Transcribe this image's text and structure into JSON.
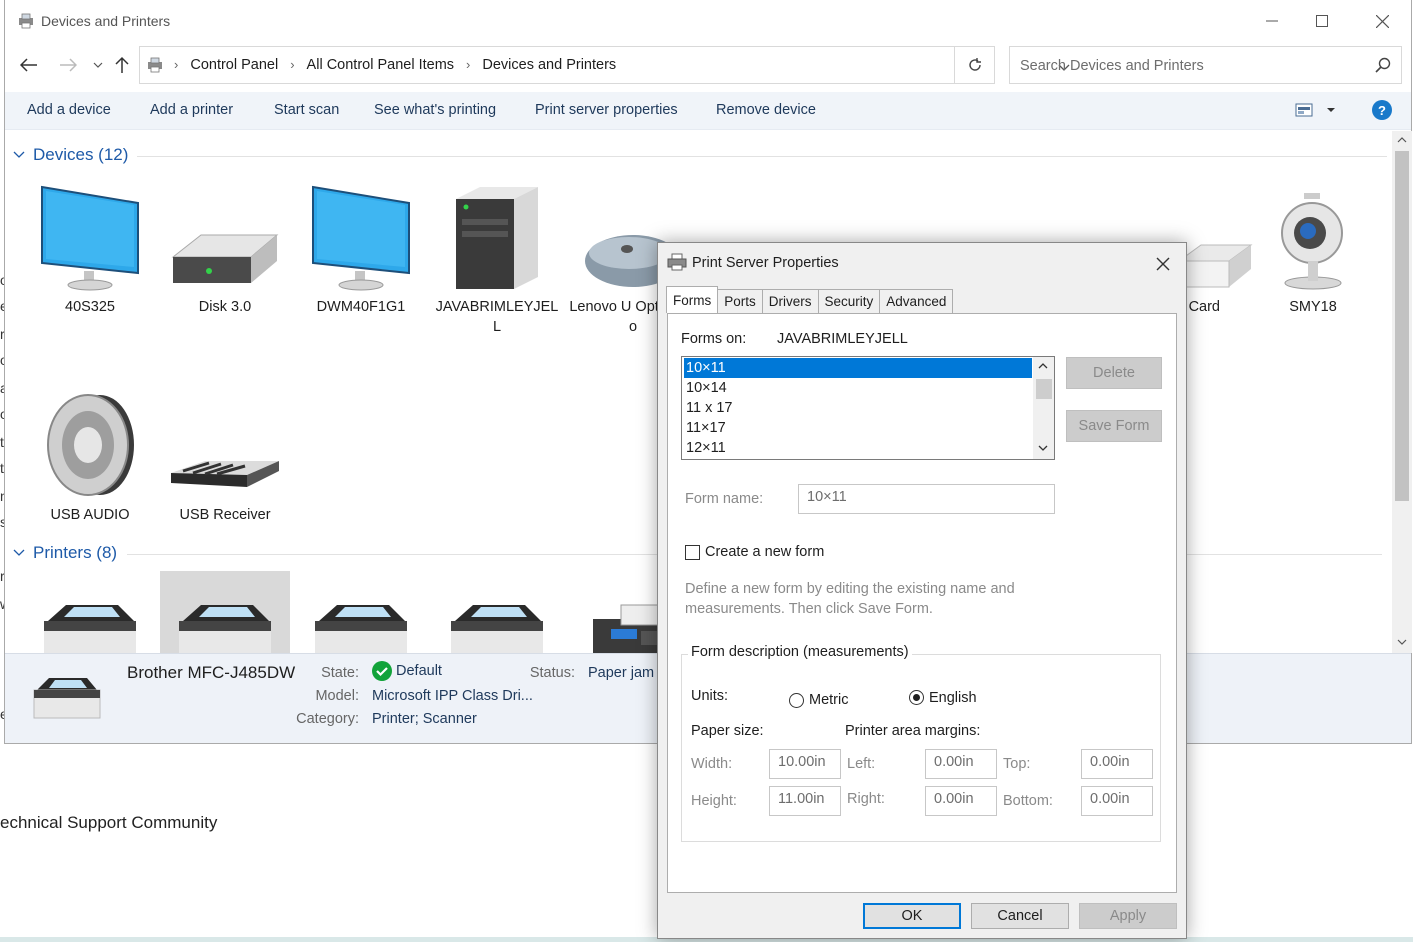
{
  "background": {
    "left_letters": [
      "o",
      "e",
      "r",
      "o",
      "a",
      "o",
      "t",
      "t",
      "n",
      "s",
      "ri",
      "w",
      "e"
    ],
    "community_text": "echnical Support Community"
  },
  "window": {
    "title": "Devices and Printers",
    "address": [
      "Control Panel",
      "All Control Panel Items",
      "Devices and Printers"
    ],
    "search_placeholder": "Search Devices and Printers"
  },
  "toolbar": {
    "items": [
      "Add a device",
      "Add a printer",
      "Start scan",
      "See what's printing",
      "Print server properties",
      "Remove device"
    ],
    "help_label": "?"
  },
  "groups": {
    "devices_label": "Devices (12)",
    "printers_label": "Printers (8)"
  },
  "devices": [
    {
      "label": "40S325",
      "icon": "monitor-icon"
    },
    {
      "label": "Disk 3.0",
      "icon": "drive-icon"
    },
    {
      "label": "DWM40F1G1",
      "icon": "monitor-icon"
    },
    {
      "label": "JAVABRIMLEYJEL L",
      "icon": "computer-tower-icon"
    },
    {
      "label": "Lenovo U Optical Mo",
      "icon": "mouse-icon"
    },
    {
      "label": "Card",
      "icon": "card-reader-icon"
    },
    {
      "label": "SMY18",
      "icon": "webcam-icon"
    },
    {
      "label": "USB  AUDIO",
      "icon": "speaker-icon"
    },
    {
      "label": "USB Receiver",
      "icon": "keyboard-icon"
    }
  ],
  "details": {
    "name": "Brother MFC-J485DW",
    "state_label": "State:",
    "state_value": "Default",
    "status_label": "Status:",
    "status_value": "Paper jam",
    "model_label": "Model:",
    "model_value": "Microsoft IPP Class Dri...",
    "category_label": "Category:",
    "category_value": "Printer; Scanner"
  },
  "dialog": {
    "title": "Print Server Properties",
    "tabs": [
      "Forms",
      "Ports",
      "Drivers",
      "Security",
      "Advanced"
    ],
    "forms_on_label": "Forms on:",
    "forms_on_value": "JAVABRIMLEYJELL",
    "forms": [
      "10×11",
      "10×14",
      "11 x 17",
      "11×17",
      "12×11"
    ],
    "delete_label": "Delete",
    "save_form_label": "Save Form",
    "form_name_label": "Form name:",
    "form_name_value": "10×11",
    "create_new_label": "Create a new form",
    "hint_line1": "Define a new form by editing the existing name and",
    "hint_line2": "measurements. Then click Save Form.",
    "group_label": "Form description (measurements)",
    "units_label": "Units:",
    "metric_label": "Metric",
    "english_label": "English",
    "paper_size_label": "Paper size:",
    "margins_label": "Printer area margins:",
    "width_label": "Width:",
    "width_value": "10.00in",
    "height_label": "Height:",
    "height_value": "11.00in",
    "left_label": "Left:",
    "left_value": "0.00in",
    "right_label": "Right:",
    "right_value": "0.00in",
    "top_label": "Top:",
    "top_value": "0.00in",
    "bottom_label": "Bottom:",
    "bottom_value": "0.00in",
    "ok_label": "OK",
    "cancel_label": "Cancel",
    "apply_label": "Apply"
  },
  "colors": {
    "accent": "#0078d7",
    "link_blue": "#1e5aa8",
    "toolbar_bg": "#f0f4f9",
    "default_check": "#12a33a"
  }
}
